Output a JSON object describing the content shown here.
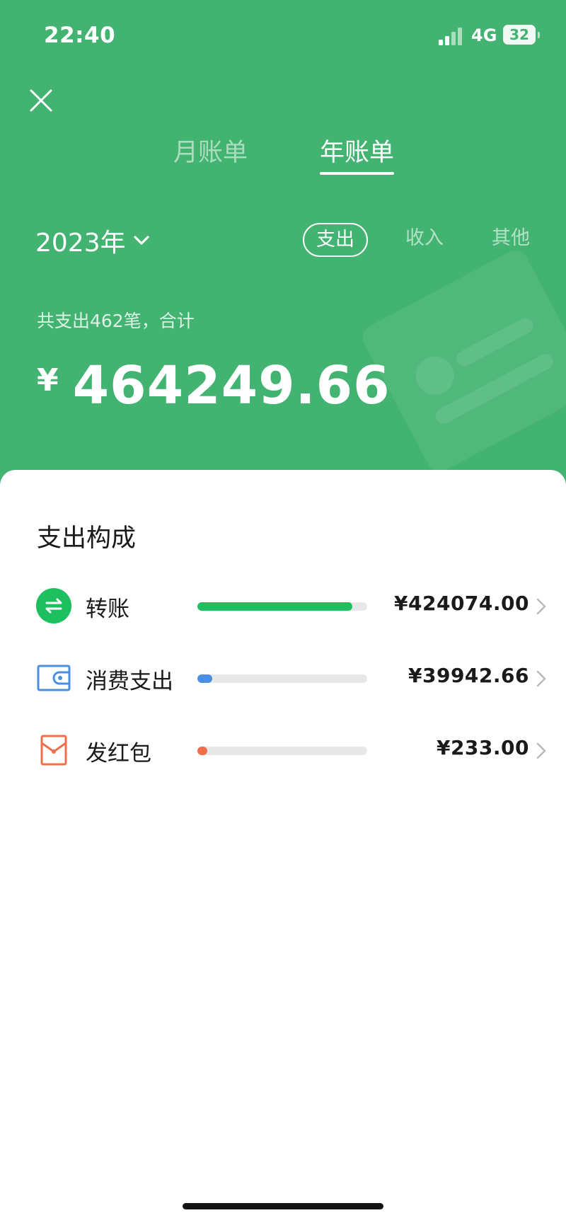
{
  "status_bar": {
    "time": "22:40",
    "network": "4G",
    "battery": "32"
  },
  "header": {
    "tabs": [
      {
        "label": "月账单",
        "active": false
      },
      {
        "label": "年账单",
        "active": true
      }
    ],
    "year_label": "2023年",
    "segments": [
      {
        "label": "支出",
        "active": true
      },
      {
        "label": "收入",
        "active": false
      },
      {
        "label": "其他",
        "active": false
      }
    ],
    "summary_text": "共支出462笔，合计",
    "currency_symbol": "¥",
    "total_amount": "464249.66"
  },
  "breakdown": {
    "title": "支出构成",
    "items": [
      {
        "label": "转账",
        "amount": "¥424074.00",
        "share": 0.913,
        "color": "#1dbf5e",
        "icon": "transfer-icon"
      },
      {
        "label": "消费支出",
        "amount": "¥39942.66",
        "share": 0.086,
        "color": "#4a90e2",
        "icon": "wallet-icon"
      },
      {
        "label": "发红包",
        "amount": "¥233.00",
        "share": 0.0005,
        "color": "#f06e4c",
        "icon": "red-packet-icon"
      }
    ]
  },
  "colors": {
    "header_green": "#42b370",
    "transfer_green": "#1dbf5e",
    "wallet_blue": "#4a90e2",
    "red_packet_orange": "#f06e4c"
  }
}
